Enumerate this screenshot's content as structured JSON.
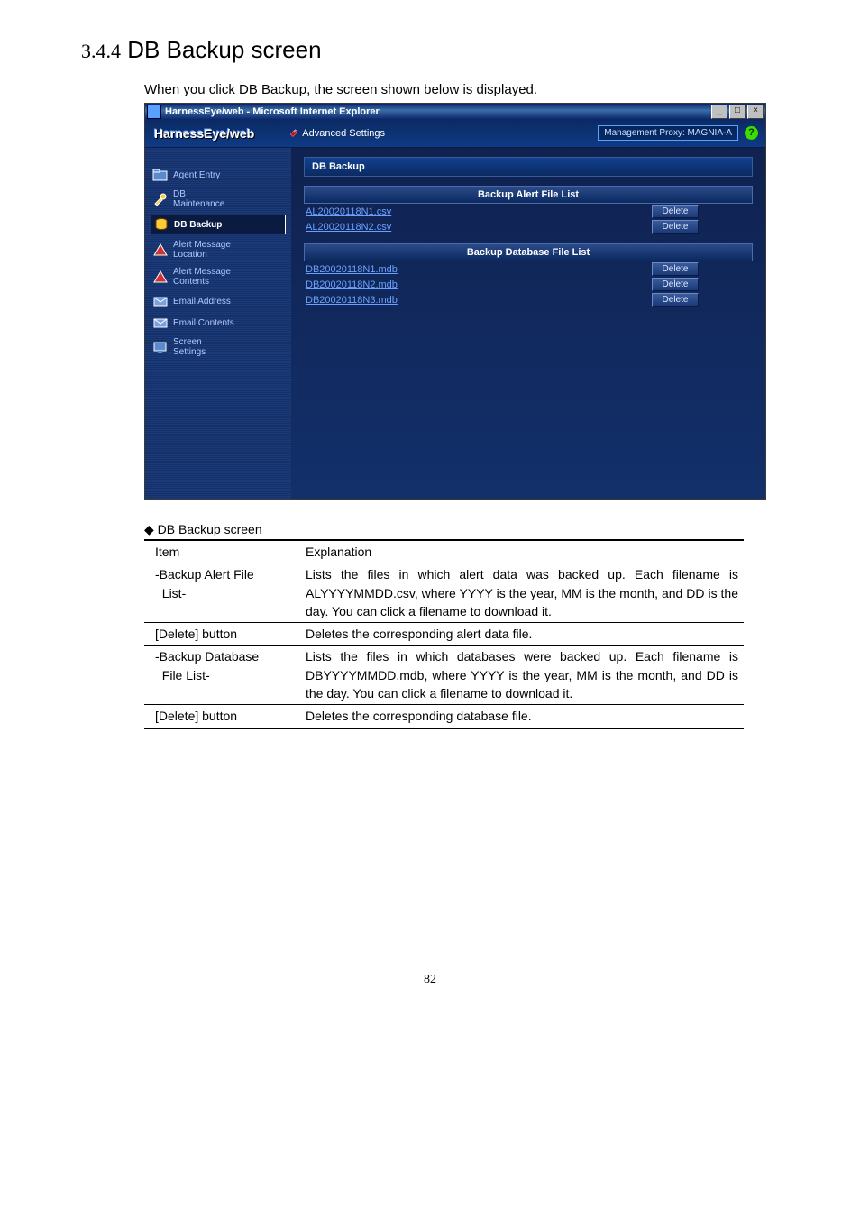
{
  "heading": {
    "number": "3.4.4",
    "title": "DB Backup screen"
  },
  "intro": "When you click DB Backup, the screen shown below is displayed.",
  "browser": {
    "title": "HarnessEye/web - Microsoft Internet Explorer",
    "win": {
      "min": "_",
      "max": "□",
      "close": "×"
    }
  },
  "app": {
    "logo": "HarnessEye/web",
    "advanced": "Advanced Settings",
    "proxy": "Management Proxy: MAGNIA-A",
    "help": "?"
  },
  "sidebar": {
    "items": [
      {
        "label": "Agent Entry"
      },
      {
        "label": "DB\nMaintenance"
      },
      {
        "label": "DB Backup"
      },
      {
        "label": "Alert Message\nLocation"
      },
      {
        "label": "Alert Message\nContents"
      },
      {
        "label": "Email Address"
      },
      {
        "label": "Email Contents"
      },
      {
        "label": "Screen\nSettings"
      }
    ]
  },
  "content": {
    "panel_title": "DB Backup",
    "alert_list": {
      "header": "Backup Alert File List",
      "rows": [
        {
          "file": "AL20020118N1.csv",
          "btn": "Delete"
        },
        {
          "file": "AL20020118N2.csv",
          "btn": "Delete"
        }
      ]
    },
    "db_list": {
      "header": "Backup Database File List",
      "rows": [
        {
          "file": "DB20020118N1.mdb",
          "btn": "Delete"
        },
        {
          "file": "DB20020118N2.mdb",
          "btn": "Delete"
        },
        {
          "file": "DB20020118N3.mdb",
          "btn": "Delete"
        }
      ]
    }
  },
  "desc": {
    "caption": "DB Backup screen",
    "header": {
      "item": "Item",
      "expl": "Explanation"
    },
    "rows": [
      {
        "item": "-Backup Alert File List-",
        "expl": "Lists the files in which alert data was backed up.   Each filename is ALYYYYMMDD.csv, where YYYY is the year, MM is the month, and DD is the day.   You can click a filename to download it."
      },
      {
        "item": "[Delete] button",
        "expl": "Deletes the corresponding alert data file."
      },
      {
        "item": "-Backup Database File List-",
        "expl": "Lists the files in which databases were backed up.   Each filename is DBYYYYMMDD.mdb, where YYYY is the year, MM is the month, and DD is the day.   You can click a filename to download it."
      },
      {
        "item": "[Delete] button",
        "expl": "Deletes the corresponding database file."
      }
    ]
  },
  "page_number": "82"
}
